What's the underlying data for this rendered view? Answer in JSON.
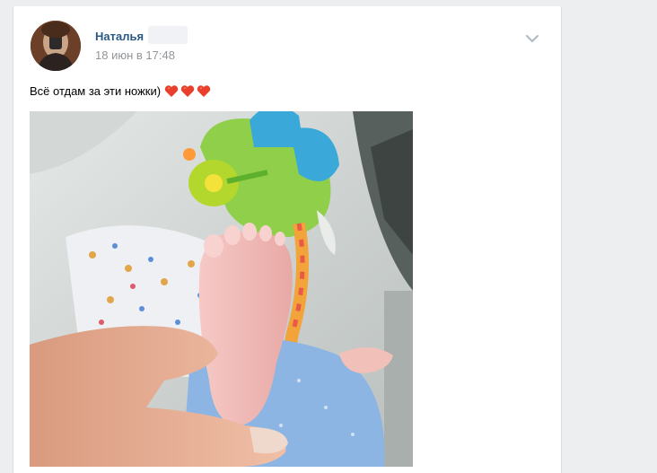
{
  "post": {
    "author_name": "Наталья",
    "date": "18 июн в 17:48",
    "text": "Всё отдам за эти ножки)",
    "emoji_icons": [
      "heart-icon",
      "heart-icon",
      "heart-icon"
    ],
    "photo": "baby-foot-photo"
  },
  "colors": {
    "link": "#2a5885",
    "date": "#939699",
    "background": "#edeef0",
    "heart": "#e8402c"
  }
}
